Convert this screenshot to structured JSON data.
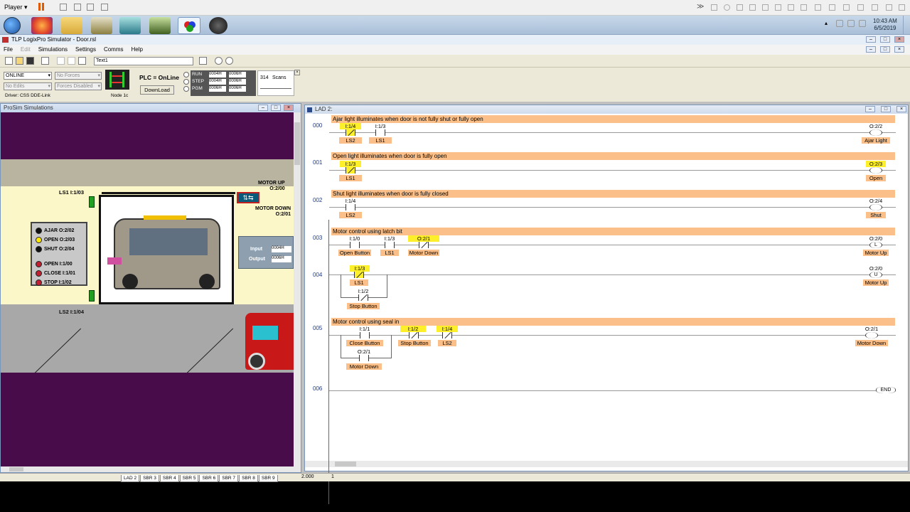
{
  "player": {
    "label": "Player"
  },
  "tray": {
    "time": "10:43 AM",
    "date": "6/5/2019"
  },
  "app": {
    "title": "TLP LogixPro Simulator - Door.rsl"
  },
  "menu": [
    "File",
    "Edit",
    "Simulations",
    "Settings",
    "Comms",
    "Help"
  ],
  "toolbar": {
    "text_field": "Text1"
  },
  "plc": {
    "mode_value": "ONLINE",
    "forces_value": "No Forces",
    "edits_value": "No Edits",
    "forces_enabled_value": "Forces Disabled",
    "driver": "Driver: CSS DDE-Link",
    "node": "Node 1c",
    "status": "PLC = OnLine",
    "download": "DownLoad",
    "run": "RUN",
    "step": "STEP",
    "pgm": "PGM",
    "reg": [
      "0004H",
      "0006H",
      "0004H",
      "0006H",
      "0006H",
      "0006H"
    ],
    "scans_value": "314",
    "scans_label": "Scans"
  },
  "sim": {
    "title": "ProSim Simulations",
    "motor_up": "MOTOR UP",
    "motor_up_addr": "O:2/00",
    "motor_down": "MOTOR DOWN",
    "motor_down_addr": "O:2/01",
    "ls1": "LS1  I:1/03",
    "ls2": "LS2  I:1/04",
    "legend": [
      {
        "t": "AJAR  O:2/02",
        "c": "#111"
      },
      {
        "t": "OPEN  O:2/03",
        "c": "#ffe800"
      },
      {
        "t": "SHUT  O:2/04",
        "c": "#111"
      },
      {
        "t": "OPEN   I:1/00",
        "c": "#c02030"
      },
      {
        "t": "CLOSE I:1/01",
        "c": "#c02030"
      },
      {
        "t": "STOP   I:1/02",
        "c": "#c02030"
      }
    ],
    "input_label": "Input",
    "input_value": "0004H",
    "output_label": "Output",
    "output_value": "0006H"
  },
  "ladder": {
    "title": "LAD 2:",
    "rungs": [
      {
        "num": "000",
        "comment": "Ajar light illuminates when door is not fully shut or fully open"
      },
      {
        "num": "001",
        "comment": "Open light illuminates when door is fully open"
      },
      {
        "num": "002",
        "comment": "Shut light illuminates when door is fully closed"
      },
      {
        "num": "003",
        "comment": "Motor control using latch bit"
      },
      {
        "num": "004",
        "comment": ""
      },
      {
        "num": "005",
        "comment": "Motor control using seal in"
      },
      {
        "num": "006",
        "comment": ""
      }
    ],
    "end": "END",
    "r0": {
      "c1a": "I:1/4",
      "c1l": "LS2",
      "c2a": "I:1/3",
      "c2l": "LS1",
      "oa": "O:2/2",
      "ol": "Ajar Light"
    },
    "r1": {
      "c1a": "I:1/3",
      "c1l": "LS1",
      "oa": "O:2/3",
      "ol": "Open"
    },
    "r2": {
      "c1a": "I:1/4",
      "c1l": "LS2",
      "oa": "O:2/4",
      "ol": "Shut"
    },
    "r3": {
      "c1a": "I:1/0",
      "c1l": "Open Button",
      "c2a": "I:1/3",
      "c2l": "LS1",
      "c3a": "O:2/1",
      "c3l": "Motor Down",
      "oa": "O:2/0",
      "ol": "Motor Up",
      "coil": "L"
    },
    "r4": {
      "c1a": "I:1/3",
      "c1l": "LS1",
      "c2a": "I:1/2",
      "c2l": "Stop Button",
      "oa": "O:2/0",
      "ol": "Motor Up",
      "coil": "U"
    },
    "r5": {
      "c1a": "I:1/1",
      "c1l": "Close Button",
      "c2a": "I:1/2",
      "c2l": "Stop Button",
      "c3a": "I:1/4",
      "c3l": "LS2",
      "c4a": "O:2/1",
      "c4l": "Motor Down",
      "oa": "O:2/1",
      "ol": "Motor Down"
    }
  },
  "tabs": [
    "LAD 2",
    "SBR 3",
    "SBR 4",
    "SBR 5",
    "SBR 6",
    "SBR 7",
    "SBR 8",
    "SBR 9"
  ],
  "status": {
    "zoom": "2.000",
    "pos": "1"
  }
}
